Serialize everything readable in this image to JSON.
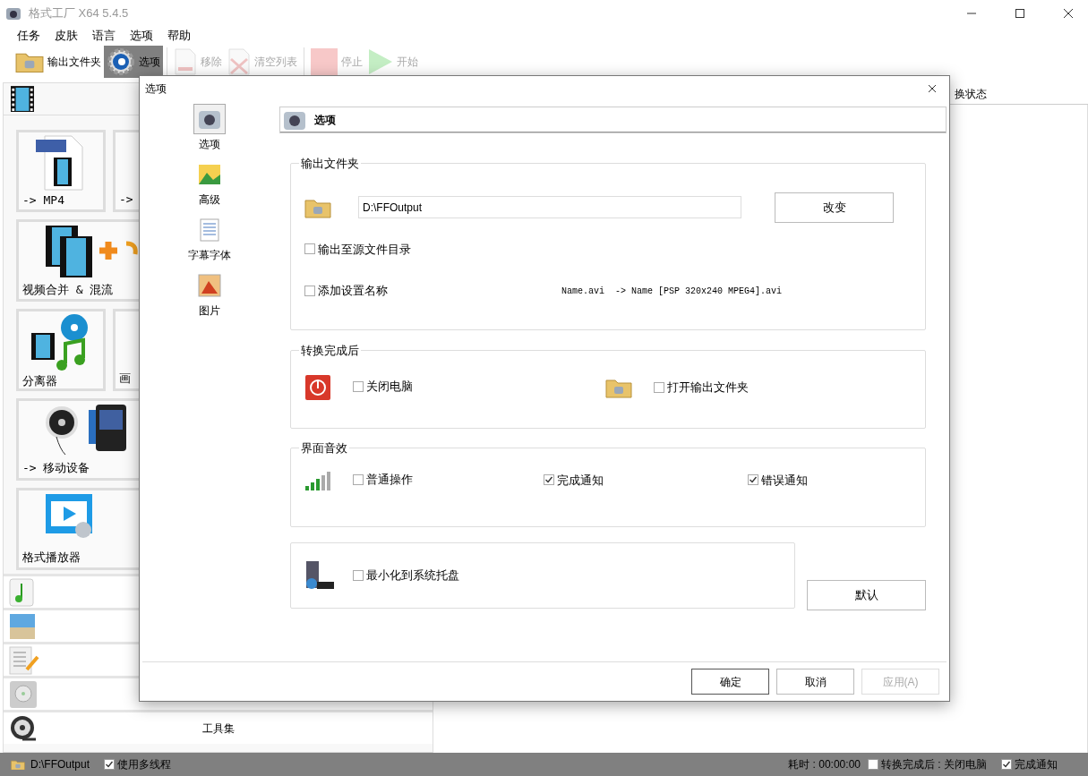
{
  "window": {
    "title": "格式工厂 X64 5.4.5"
  },
  "menu": [
    "任务",
    "皮肤",
    "语言",
    "选项",
    "帮助"
  ],
  "toolbar": [
    {
      "kind": "folder",
      "label": "输出文件夹",
      "disabled": false,
      "selected": false
    },
    {
      "kind": "gear",
      "label": "选项",
      "disabled": false,
      "selected": true
    },
    {
      "kind": "remove",
      "label": "移除",
      "disabled": true,
      "selected": false
    },
    {
      "kind": "clear",
      "label": "清空列表",
      "disabled": true,
      "selected": false
    },
    {
      "kind": "stop",
      "label": "停止",
      "disabled": true,
      "selected": false
    },
    {
      "kind": "start",
      "label": "开始",
      "disabled": true,
      "selected": false
    }
  ],
  "sidebar": {
    "tiles": [
      {
        "kind": "mp4",
        "label": "-> MP4",
        "wide": false
      },
      {
        "kind": "cut",
        "label": "->",
        "wide": false
      },
      {
        "kind": "merge",
        "label": "视频合并 & 混流",
        "wide": true
      },
      {
        "kind": "splitter",
        "label": "分离器",
        "wide": false
      },
      {
        "kind": "crop",
        "label": "画",
        "wide": false
      },
      {
        "kind": "mobile",
        "label": "-> 移动设备",
        "wide": true
      },
      {
        "kind": "player",
        "label": "格式播放器",
        "wide": true
      }
    ],
    "sections": [
      {
        "kind": "audio"
      },
      {
        "kind": "picture"
      },
      {
        "kind": "document"
      },
      {
        "kind": "disc"
      },
      {
        "kind": "tools",
        "label": "工具集"
      }
    ]
  },
  "task_list": {
    "columns": [
      "换状态"
    ]
  },
  "status_bar": {
    "folder": "D:\\FFOutput",
    "multithread": {
      "label": "使用多线程",
      "checked": true
    },
    "elapsed": "耗时 : 00:00:00",
    "shutdown": {
      "label": "转换完成后 : 关闭电脑",
      "checked": false
    },
    "notify": {
      "label": "完成通知",
      "checked": true
    }
  },
  "dialog": {
    "title": "选项",
    "nav": [
      {
        "kind": "options",
        "label": "选项",
        "selected": true
      },
      {
        "kind": "advanced",
        "label": "高级",
        "selected": false
      },
      {
        "kind": "subtitle",
        "label": "字幕字体",
        "selected": false
      },
      {
        "kind": "image",
        "label": "图片",
        "selected": false
      }
    ],
    "header": "选项",
    "output_folder": {
      "legend": "输出文件夹",
      "path": "D:\\FFOutput",
      "change_button": "改变",
      "to_source": {
        "label": "输出至源文件目录",
        "checked": false
      },
      "add_name": {
        "label": "添加设置名称",
        "checked": false
      },
      "example": "Name.avi  -> Name [PSP 320x240 MPEG4].avi"
    },
    "after_convert": {
      "legend": "转换完成后",
      "shutdown": {
        "label": "关闭电脑",
        "checked": false
      },
      "open_folder": {
        "label": "打开输出文件夹",
        "checked": false
      }
    },
    "sounds": {
      "legend": "界面音效",
      "options": [
        {
          "label": "普通操作",
          "checked": false
        },
        {
          "label": "完成通知",
          "checked": true
        },
        {
          "label": "错误通知",
          "checked": true
        }
      ]
    },
    "tray": {
      "label": "最小化到系统托盘",
      "checked": false
    },
    "default_button": "默认",
    "buttons": [
      {
        "label": "确定",
        "disabled": false,
        "primary": true
      },
      {
        "label": "取消",
        "disabled": false,
        "primary": false
      },
      {
        "label": "应用(A)",
        "disabled": true,
        "primary": false
      }
    ]
  }
}
